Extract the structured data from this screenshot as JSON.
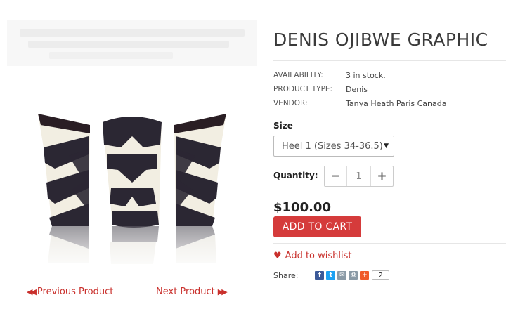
{
  "product": {
    "title": "DENIS OJIBWE GRAPHIC",
    "image_alt": "Three shoe heel covers with Ojibwe graphic pattern",
    "meta": [
      {
        "key": "AVAILABILITY:",
        "value": "3 in stock."
      },
      {
        "key": "PRODUCT TYPE:",
        "value": "Denis"
      },
      {
        "key": "VENDOR:",
        "value": "Tanya Heath Paris Canada"
      }
    ],
    "size_label": "Size",
    "size_selected": "Heel 1 (Sizes 34-36.5)",
    "quantity_label": "Quantity:",
    "quantity_value": "1",
    "price": "$100.00",
    "add_to_cart_label": "ADD TO CART",
    "wishlist_label": "Add to wishlist",
    "share_label": "Share:",
    "share_count": "2"
  },
  "nav": {
    "previous_label": "Previous Product",
    "next_label": "Next Product"
  },
  "icons": {
    "facebook": "facebook-icon",
    "twitter": "twitter-icon",
    "email": "email-icon",
    "print": "print-icon",
    "plus": "addthis-plus-icon"
  },
  "colors": {
    "accent": "#d53b3b",
    "link": "#c9302c"
  }
}
